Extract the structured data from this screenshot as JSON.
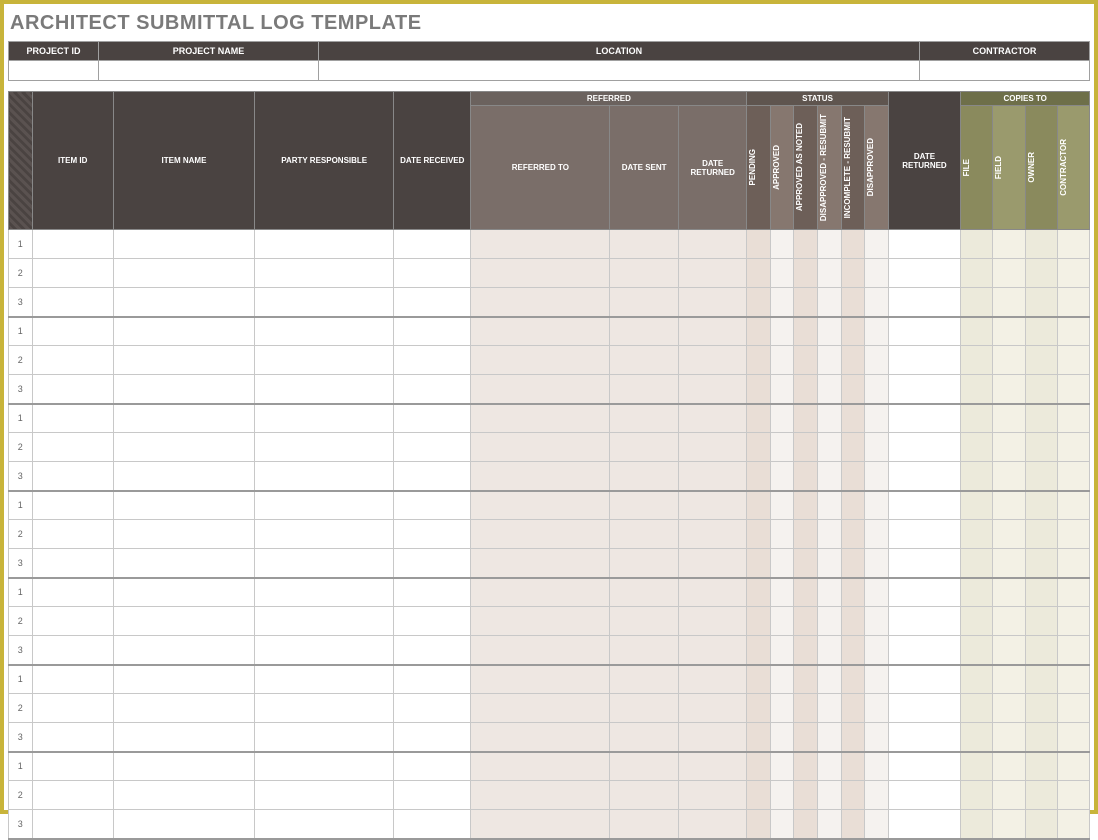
{
  "title": "ARCHITECT SUBMITTAL LOG TEMPLATE",
  "project_header": {
    "project_id_label": "PROJECT ID",
    "project_name_label": "PROJECT NAME",
    "location_label": "LOCATION",
    "contractor_label": "CONTRACTOR",
    "project_id": "",
    "project_name": "",
    "location": "",
    "contractor": ""
  },
  "columns": {
    "item_id": "ITEM ID",
    "item_name": "ITEM NAME",
    "party_responsible": "PARTY RESPONSIBLE",
    "date_received": "DATE RECEIVED",
    "referred_group": "REFERRED",
    "referred_to": "REFERRED TO",
    "date_sent": "DATE SENT",
    "date_returned": "DATE RETURNED",
    "status_group": "STATUS",
    "status_pending": "PENDING",
    "status_approved": "APPROVED",
    "status_approved_as_noted": "APPROVED AS NOTED",
    "status_disapproved_resubmit": "DISAPPROVED - RESUBMIT",
    "status_incomplete_resubmit": "INCOMPLETE - RESUBMIT",
    "status_disapproved": "DISAPPROVED",
    "date_returned2": "DATE RETURNED",
    "copies_group": "COPIES TO",
    "copies_file": "FILE",
    "copies_field": "FIELD",
    "copies_owner": "OWNER",
    "copies_contractor": "CONTRACTOR"
  },
  "groups": [
    {
      "rows": [
        {
          "n": "1"
        },
        {
          "n": "2"
        },
        {
          "n": "3"
        }
      ]
    },
    {
      "rows": [
        {
          "n": "1"
        },
        {
          "n": "2"
        },
        {
          "n": "3"
        }
      ]
    },
    {
      "rows": [
        {
          "n": "1"
        },
        {
          "n": "2"
        },
        {
          "n": "3"
        }
      ]
    },
    {
      "rows": [
        {
          "n": "1"
        },
        {
          "n": "2"
        },
        {
          "n": "3"
        }
      ]
    },
    {
      "rows": [
        {
          "n": "1"
        },
        {
          "n": "2"
        },
        {
          "n": "3"
        }
      ]
    },
    {
      "rows": [
        {
          "n": "1"
        },
        {
          "n": "2"
        },
        {
          "n": "3"
        }
      ]
    },
    {
      "rows": [
        {
          "n": "1"
        },
        {
          "n": "2"
        },
        {
          "n": "3"
        }
      ]
    }
  ]
}
